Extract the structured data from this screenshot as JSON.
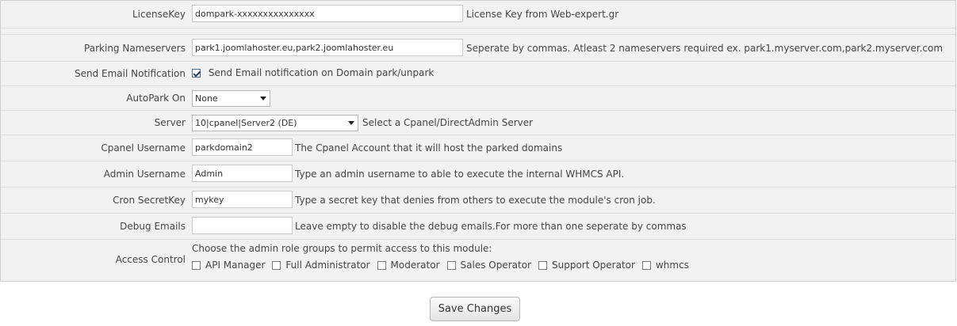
{
  "license": {
    "label": "LicenseKey",
    "value": "dompark-xxxxxxxxxxxxxxx",
    "desc": "License Key from Web-expert.gr"
  },
  "nameservers": {
    "label": "Parking Nameservers",
    "value": "park1.joomlahoster.eu,park2.joomlahoster.eu",
    "desc": "Seperate by commas. Atleast 2 nameservers required ex. park1.myserver.com,park2.myserver.com"
  },
  "email_notification": {
    "label": "Send Email Notification",
    "checked": true,
    "checkbox_label": "Send Email notification on Domain park/unpark"
  },
  "autopark": {
    "label": "AutoPark On",
    "selected": "None"
  },
  "server": {
    "label": "Server",
    "selected": "10|cpanel|Server2 (DE)",
    "desc": "Select a Cpanel/DirectAdmin Server"
  },
  "cpanel_username": {
    "label": "Cpanel Username",
    "value": "parkdomain2",
    "desc": "The Cpanel Account that it will host the parked domains"
  },
  "admin_username": {
    "label": "Admin Username",
    "value": "Admin",
    "desc": "Type an admin username to able to execute the internal WHMCS API."
  },
  "cron_secret": {
    "label": "Cron SecretKey",
    "value": "mykey",
    "desc": "Type a secret key that denies from others to execute the module's cron job."
  },
  "debug_emails": {
    "label": "Debug Emails",
    "value": "",
    "desc": "Leave empty to disable the debug emails.For more than one seperate by commas"
  },
  "access_control": {
    "label": "Access Control",
    "intro": "Choose the admin role groups to permit access to this module:",
    "roles": [
      {
        "name": "API Manager",
        "checked": false
      },
      {
        "name": "Full Administrator",
        "checked": false
      },
      {
        "name": "Moderator",
        "checked": false
      },
      {
        "name": "Sales Operator",
        "checked": false
      },
      {
        "name": "Support Operator",
        "checked": false
      },
      {
        "name": "whmcs",
        "checked": false
      }
    ]
  },
  "save_label": "Save Changes"
}
